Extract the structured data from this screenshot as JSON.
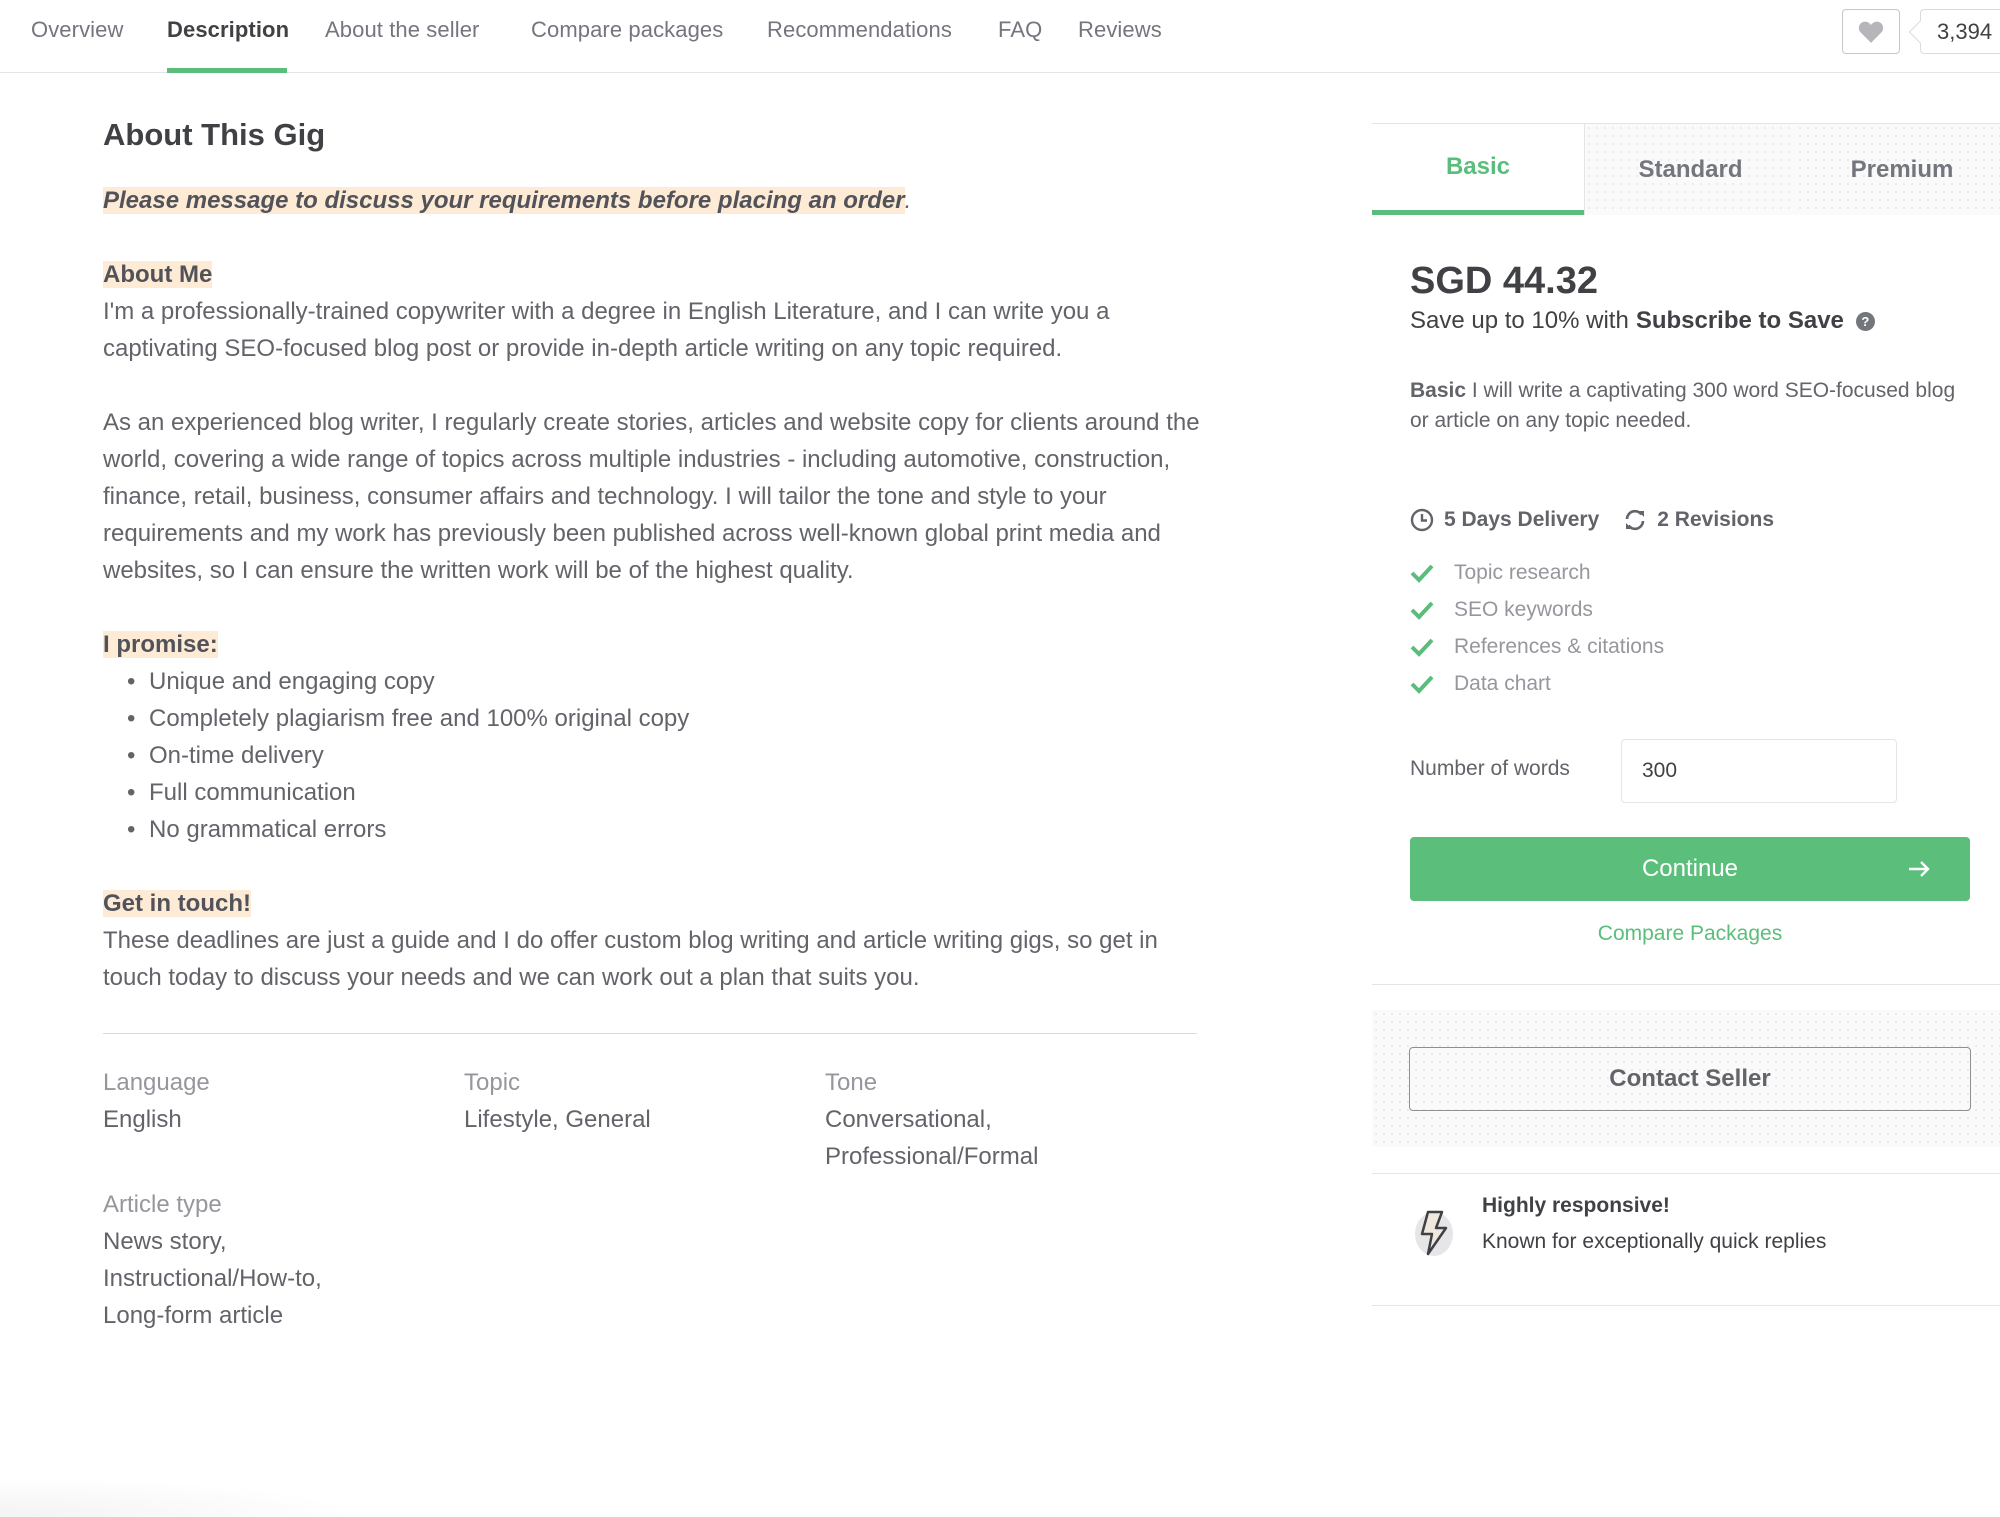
{
  "nav": {
    "items": [
      {
        "label": "Overview",
        "active": false
      },
      {
        "label": "Description",
        "active": true
      },
      {
        "label": "About the seller",
        "active": false
      },
      {
        "label": "Compare packages",
        "active": false
      },
      {
        "label": "Recommendations",
        "active": false
      },
      {
        "label": "FAQ",
        "active": false
      },
      {
        "label": "Reviews",
        "active": false
      }
    ],
    "favorite_icon": "heart-icon",
    "favorite_count": "3,394"
  },
  "description": {
    "title": "About This Gig",
    "notice": "Please message to discuss your requirements before placing an order",
    "notice_tail": ".",
    "about_heading": "About Me",
    "about_text": "I'm a professionally-trained copywriter with a degree in English Literature, and I can write you a captivating SEO-focused blog post or provide in-depth article writing on any topic required.",
    "experience_text": "As an experienced blog writer, I regularly create stories, articles and website copy for clients around the world, covering a wide range of topics across multiple industries - including automotive, construction, finance, retail, business, consumer affairs and technology. I will tailor the tone and style to your requirements and my work has previously been published across well-known global print media and websites, so I can ensure the written work will be of the highest quality.",
    "promise_heading": "I promise:",
    "promises": [
      "Unique and engaging copy",
      "Completely plagiarism free and 100% original copy",
      "On-time delivery",
      "Full communication",
      "No grammatical errors"
    ],
    "contact_heading": "Get in touch!",
    "contact_text": "These deadlines are just a guide and I do offer custom blog writing and article writing gigs, so get in touch today to discuss your needs and we can work out a plan that suits you."
  },
  "metadata": [
    {
      "label": "Language",
      "value": "English"
    },
    {
      "label": "Topic",
      "value": "Lifestyle, General"
    },
    {
      "label": "Tone",
      "value": "Conversational,\nProfessional/Formal"
    },
    {
      "label": "Article type",
      "value": "News story,\nInstructional/How-to,\nLong-form article"
    }
  ],
  "package": {
    "tabs": [
      {
        "label": "Basic",
        "active": true
      },
      {
        "label": "Standard",
        "active": false
      },
      {
        "label": "Premium",
        "active": false
      }
    ],
    "price": "SGD 44.32",
    "save_prefix": "Save up to 10% with",
    "save_link": "Subscribe to Save",
    "help_icon": "question-circle-icon",
    "desc_title": "Basic",
    "desc_text": "I will write a captivating 300 word SEO-focused blog or article on any topic needed.",
    "delivery": "5 Days Delivery",
    "revisions": "2 Revisions",
    "features": [
      {
        "label": "Topic research",
        "included": true
      },
      {
        "label": "SEO keywords",
        "included": true
      },
      {
        "label": "References & citations",
        "included": true
      },
      {
        "label": "Data chart",
        "included": true
      }
    ],
    "words_label": "Number of words",
    "words_value": "300",
    "continue_label": "Continue",
    "compare_label": "Compare Packages",
    "contact_label": "Contact Seller",
    "badge_title": "Highly responsive!",
    "badge_subtitle": "Known for exceptionally quick replies"
  },
  "colors": {
    "accent_green": "#5bbf7b",
    "highlight": "#fdebd5",
    "text_dark": "#404145",
    "text_muted": "#62646a"
  }
}
